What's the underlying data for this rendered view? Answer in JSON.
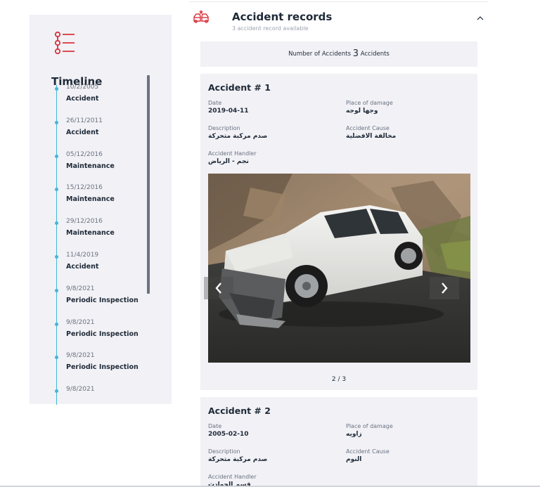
{
  "timeline": {
    "title": "Timeline",
    "items": [
      {
        "date": "10/2/2005",
        "event": "Accident"
      },
      {
        "date": "26/11/2011",
        "event": "Accident"
      },
      {
        "date": "05/12/2016",
        "event": "Maintenance"
      },
      {
        "date": "15/12/2016",
        "event": "Maintenance"
      },
      {
        "date": "29/12/2016",
        "event": "Maintenance"
      },
      {
        "date": "11/4/2019",
        "event": "Accident"
      },
      {
        "date": "9/8/2021",
        "event": "Periodic Inspection"
      },
      {
        "date": "9/8/2021",
        "event": "Periodic Inspection"
      },
      {
        "date": "9/8/2021",
        "event": "Periodic Inspection"
      },
      {
        "date": "9/8/2021",
        "event": ""
      }
    ]
  },
  "section": {
    "title": "Accident records",
    "subtitle": "3 accident record available",
    "count_prefix": "Number of Accidents",
    "count_value": "3",
    "count_suffix": "Accidents"
  },
  "accidents": [
    {
      "title": "Accident # 1",
      "date_label": "Date",
      "date": "2019-04-11",
      "place_label": "Place of damage",
      "place": "وجها لوجه",
      "description_label": "Description",
      "description": "صدم مركبة متحركة",
      "cause_label": "Accident Cause",
      "cause": "مخالفة الافضلية",
      "handler_label": "Accident Handler",
      "handler": "نجم - الرياض",
      "pager": "2 / 3"
    },
    {
      "title": "Accident # 2",
      "date_label": "Date",
      "date": "2005-02-10",
      "place_label": "Place of damage",
      "place": "زاويه",
      "description_label": "Description",
      "description": "صدم مركبة متحركة",
      "cause_label": "Accident Cause",
      "cause": "النوم",
      "handler_label": "Accident Handler",
      "handler": "قسم الحوادث"
    }
  ],
  "icons": {
    "timeline": "list-timeline-icon",
    "section": "car-crash-icon",
    "collapse": "chevron-up-icon",
    "prev": "chevron-left-icon",
    "next": "chevron-right-icon"
  },
  "colors": {
    "accent_red": "#d9323c",
    "timeline_blue": "#42b6d8",
    "panel_bg": "#f1f1f6"
  }
}
